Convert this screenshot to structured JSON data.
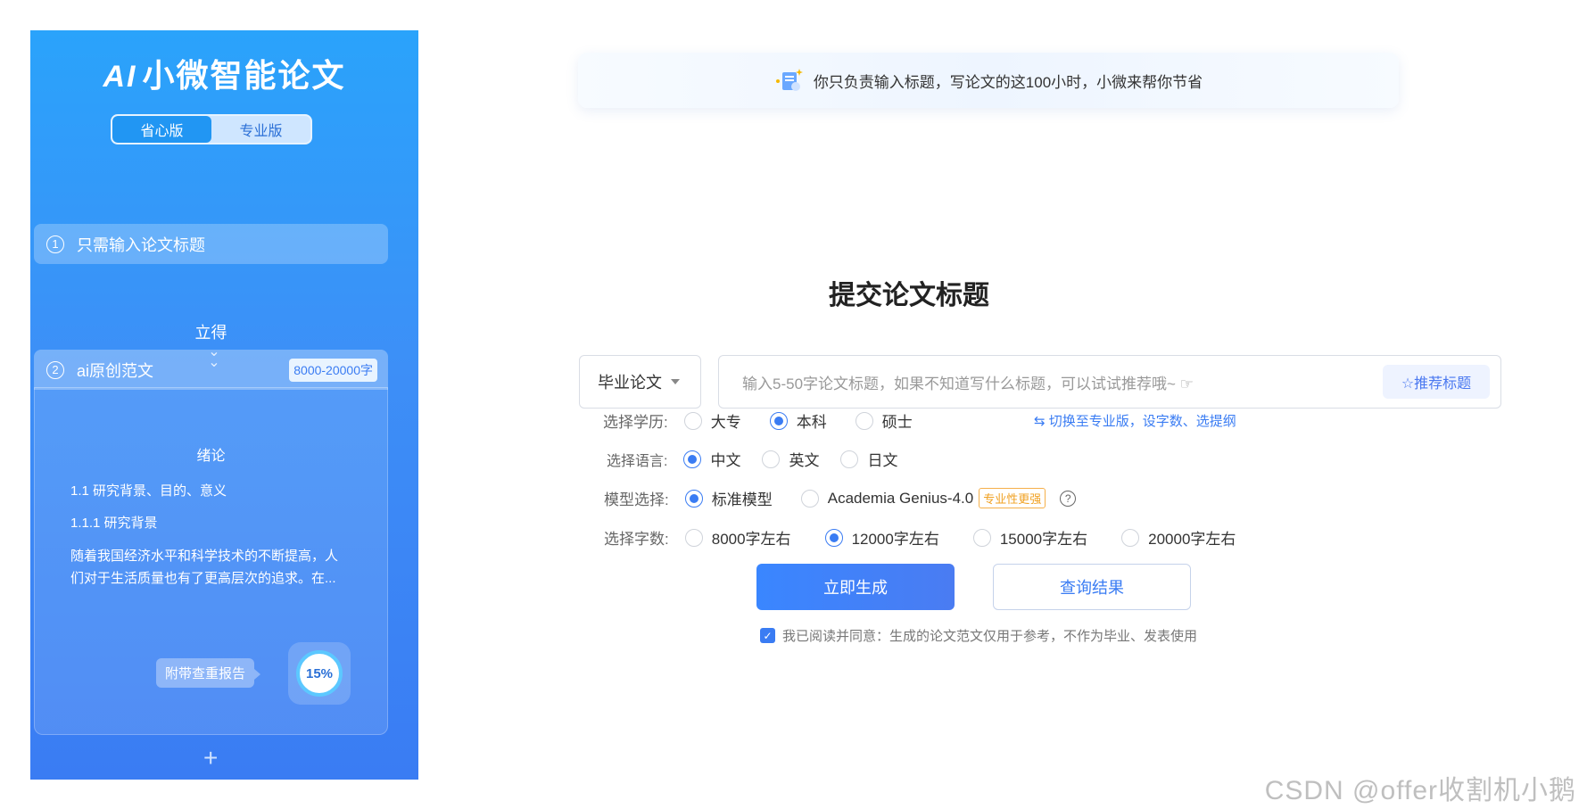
{
  "sidebar": {
    "logo_mark": "AI",
    "logo_text": "小微智能论文",
    "versions": {
      "active": "省心版",
      "inactive": "专业版"
    },
    "step1": {
      "num": "1",
      "label": "只需输入论文标题"
    },
    "arrow_text": "立得",
    "step2": {
      "num": "2",
      "label": "ai原创范文",
      "tag": "8000-20000字"
    },
    "preview": {
      "heading": "绪论",
      "line1": "1.1 研究背景、目的、意义",
      "line2": "1.1.1 研究背景",
      "paragraph": "随着我国经济水平和科学技术的不断提高，人们对于生活质量也有了更高层次的追求。在..."
    },
    "report_label": "附带查重报告",
    "report_percent": "15%",
    "plus": "+"
  },
  "main": {
    "notice": "你只负责输入标题，写论文的这100小时，小微来帮你节省",
    "title": "提交论文标题",
    "type_select": "毕业论文",
    "input_placeholder": "输入5-50字论文标题，如果不知道写什么标题，可以试试推荐哦~ ☞",
    "recommend_button": "☆推荐标题",
    "education": {
      "label": "选择学历:",
      "options": [
        "大专",
        "本科",
        "硕士"
      ],
      "selected": "本科"
    },
    "switch_link": "⇆ 切换至专业版，设字数、选提纲",
    "language": {
      "label": "选择语言:",
      "options": [
        "中文",
        "英文",
        "日文"
      ],
      "selected": "中文"
    },
    "model": {
      "label": "模型选择:",
      "options": [
        "标准模型",
        "Academia Genius-4.0"
      ],
      "selected": "标准模型",
      "pro_tag": "专业性更强",
      "help": "?"
    },
    "words": {
      "label": "选择字数:",
      "options": [
        "8000字左右",
        "12000字左右",
        "15000字左右",
        "20000字左右"
      ],
      "selected": "12000字左右"
    },
    "generate_button": "立即生成",
    "query_button": "查询结果",
    "agreement": "我已阅读并同意：生成的论文范文仅用于参考，不作为毕业、发表使用"
  },
  "watermark": "CSDN @offer收割机小鹅",
  "colors": {
    "primary": "#3a7cf3",
    "sidebar_top": "#2aa3fb",
    "tag_orange": "#f0a020"
  }
}
